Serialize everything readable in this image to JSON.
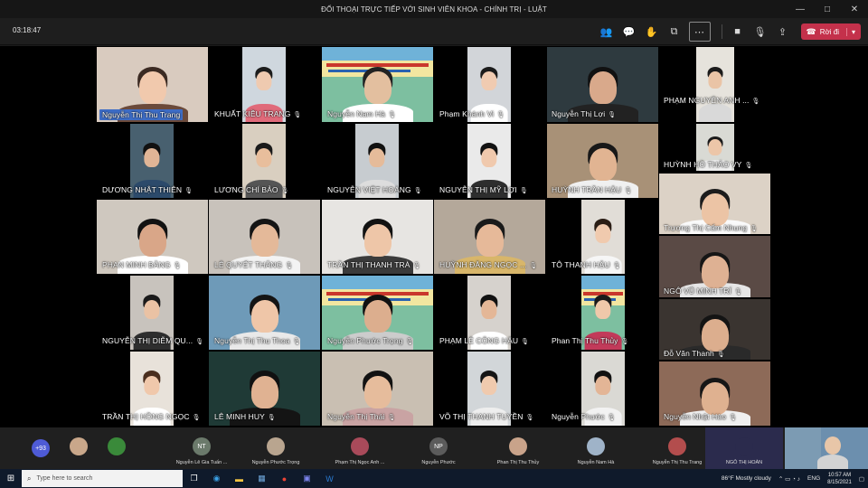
{
  "window": {
    "title": "ĐỐI THOẠI TRỰC TIẾP VỚI SINH VIÊN KHOA - CHÍNH TRỊ - LUẬT",
    "controls": [
      "—",
      "□",
      "✕"
    ]
  },
  "toolbar": {
    "timer": "03:18:47",
    "leave_label": "Rời đi"
  },
  "tiles": [
    {
      "name": "Nguyễn Thị Thu Trang",
      "highlight": true
    },
    {
      "name": "KHUẤT KIỀU TRANG"
    },
    {
      "name": "Nguyễn Nam Hà"
    },
    {
      "name": "Phạm Khánh Vi"
    },
    {
      "name": "Nguyễn Thị Lợi"
    },
    {
      "name": "PHẠM NGUYỄN ANH ..."
    },
    {
      "name": "DƯƠNG NHẬT THIÊN"
    },
    {
      "name": "LƯƠNG CHÍ BẢO"
    },
    {
      "name": "NGUYỄN VIỆT HOÀNG"
    },
    {
      "name": "NGUYỄN THỊ MỸ LỢI"
    },
    {
      "name": "HUỲNH TRẦN HẬU"
    },
    {
      "name": "HUỲNH HỒ THẢO VY"
    },
    {
      "name": "PHAN MINH BẰNG"
    },
    {
      "name": "LÊ QUYẾT THẮNG"
    },
    {
      "name": "TRẦN THỊ THANH TRÀ"
    },
    {
      "name": "HUỲNH ĐẶNG NGỌC ..."
    },
    {
      "name": "TÔ THANH HẬU"
    },
    {
      "name": "Trương Thị Cẩm Nhung"
    },
    {
      "name": "NGUYỄN THỊ DIỄM QU..."
    },
    {
      "name": "Nguyễn Thị Thu Thoa"
    },
    {
      "name": "Nguyễn Phước Trọng"
    },
    {
      "name": "PHẠM LÊ CÔNG HẬU"
    },
    {
      "name": "Phan Thị Thu Thủy"
    },
    {
      "name": "NGÔ VŨ MINH TRÍ"
    },
    {
      "name": "TRẦN THỊ HỒNG NGỌC"
    },
    {
      "name": "LÊ MINH HUY"
    },
    {
      "name": "Nguyễn Thị Thái"
    },
    {
      "name": "VÕ THỊ THANH TUYỀN"
    },
    {
      "name": "Nguyễn Phước"
    },
    {
      "name": "Đỗ Văn Thanh"
    },
    {
      "name": "Nguyễn Nhật Hào"
    }
  ],
  "strip": {
    "more_count": "+93",
    "participants": [
      {
        "name": "Nguyễn Lê Gia Tuấn ...",
        "initials": ""
      },
      {
        "name": "Nguyễn Phước Trọng",
        "initials": ""
      },
      {
        "name": "Phạm Thị Ngọc Anh ...",
        "initials": ""
      },
      {
        "name": "Nguyễn Phước",
        "initials": "NP"
      },
      {
        "name": "Phan Thị Thu Thủy",
        "initials": ""
      },
      {
        "name": "Nguyễn Nam Hà",
        "initials": ""
      },
      {
        "name": "Nguyễn Thị Thu Trang",
        "initials": ""
      },
      {
        "name": "NGÔ THỊ HOÀN",
        "initials": ""
      }
    ],
    "nt_initials": "NT"
  },
  "taskbar": {
    "search_placeholder": "Type here to search",
    "weather": "86°F  Mostly cloudy",
    "lang": "ENG",
    "time": "10:57 AM",
    "date": "8/15/2021"
  }
}
